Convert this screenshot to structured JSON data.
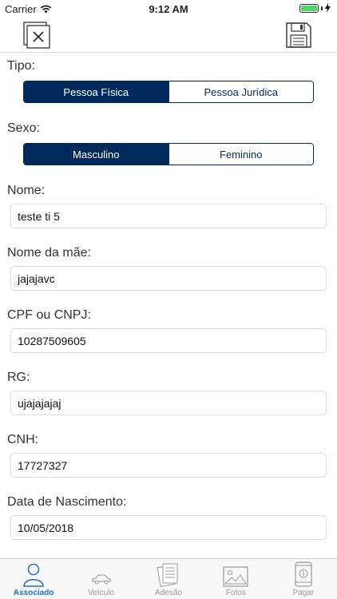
{
  "status": {
    "carrier": "Carrier",
    "time": "9:12 AM"
  },
  "nav": {
    "close_icon": "close-window-icon",
    "save_icon": "floppy-disk-icon"
  },
  "form": {
    "tipo": {
      "label": "Tipo:",
      "options": [
        "Pessoa Física",
        "Pessoa Jurídica"
      ],
      "selected": "Pessoa Física"
    },
    "sexo": {
      "label": "Sexo:",
      "options": [
        "Masculino",
        "Feminino"
      ],
      "selected": "Masculino"
    },
    "nome": {
      "label": "Nome:",
      "value": "teste ti 5"
    },
    "nome_mae": {
      "label": "Nome da mãe:",
      "value": "jajajavc"
    },
    "cpf": {
      "label": "CPF ou CNPJ:",
      "value": "10287509605"
    },
    "rg": {
      "label": "RG:",
      "value": "ujajajajaj"
    },
    "cnh": {
      "label": "CNH:",
      "value": "17727327"
    },
    "nascimento": {
      "label": "Data de Nascimento:",
      "value": "10/05/2018"
    }
  },
  "tabs": [
    {
      "label": "Associado",
      "icon": "person-icon",
      "active": true
    },
    {
      "label": "Veículo",
      "icon": "car-icon",
      "active": false
    },
    {
      "label": "Adesão",
      "icon": "documents-icon",
      "active": false
    },
    {
      "label": "Fotos",
      "icon": "photo-icon",
      "active": false
    },
    {
      "label": "Pagar",
      "icon": "phone-payment-icon",
      "active": false
    }
  ],
  "colors": {
    "primary": "#002a5c",
    "tab_active": "#1f6fcc",
    "tab_inactive": "#999999",
    "battery": "#4cd964"
  }
}
